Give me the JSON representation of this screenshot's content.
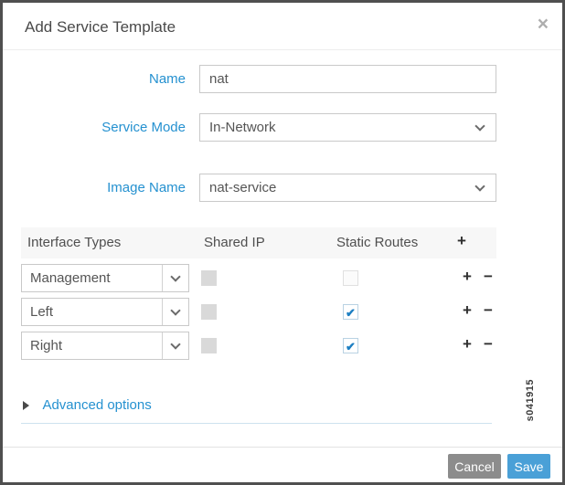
{
  "dialog": {
    "title": "Add Service Template"
  },
  "icons": {
    "close": "×",
    "check": "✔",
    "plus": "+",
    "minus": "−"
  },
  "form": {
    "fields": [
      {
        "label": "Name",
        "value": "nat",
        "type": "text"
      },
      {
        "label": "Service Mode",
        "value": "In-Network",
        "type": "select"
      },
      {
        "label": "Image Name",
        "value": "nat-service",
        "type": "select"
      }
    ]
  },
  "interface_table": {
    "headers": {
      "interface_types": "Interface Types",
      "shared_ip": "Shared IP",
      "static_routes": "Static Routes",
      "add": "+"
    },
    "rows": [
      {
        "interface_type": "Management",
        "shared_ip_checked": false,
        "shared_ip_disabled": true,
        "static_routes_checked": false
      },
      {
        "interface_type": "Left",
        "shared_ip_checked": false,
        "shared_ip_disabled": true,
        "static_routes_checked": true
      },
      {
        "interface_type": "Right",
        "shared_ip_checked": false,
        "shared_ip_disabled": true,
        "static_routes_checked": true
      }
    ]
  },
  "advanced_options": {
    "label": "Advanced options"
  },
  "watermark": "s041915",
  "footer": {
    "cancel_label": "Cancel",
    "save_label": "Save"
  },
  "colors": {
    "label_blue": "#2591d0",
    "save_button_blue": "#4aa0d7",
    "cancel_button_gray": "#8c8c8c",
    "checkbox_check_blue": "#1b7ec2",
    "dialog_border": "#4f4f4f",
    "table_header_bg": "#f7f7f7"
  }
}
